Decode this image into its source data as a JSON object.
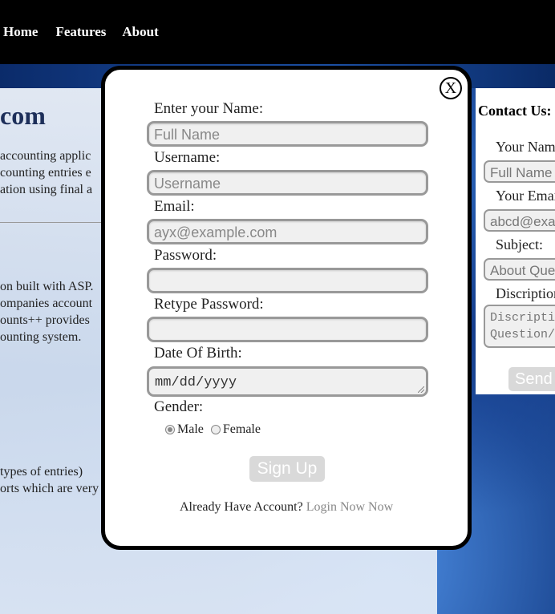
{
  "nav": {
    "items": [
      "Home",
      "Features",
      "About"
    ]
  },
  "left": {
    "brand": "com",
    "para1": "accounting applic\ncounting entries e\nation using final a",
    "para2": "on built with ASP.\nompanies account\nounts++ provides\nounting system.",
    "para3": "types of entries)\norts which are very"
  },
  "contact": {
    "title": "Contact Us:",
    "name_label": "Your Name",
    "name_placeholder": "Full Name",
    "email_label": "Your Email",
    "email_placeholder": "abcd@example.com",
    "subject_label": "Subject:",
    "subject_placeholder": "About Question",
    "description_label": "Discription",
    "description_placeholder": "Discription\nQuestion/",
    "send_label": "Send"
  },
  "modal": {
    "close_label": "X",
    "name_label": "Enter your Name:",
    "name_placeholder": "Full Name",
    "username_label": "Username:",
    "username_placeholder": "Username",
    "email_label": "Email:",
    "email_placeholder": "ayx@example.com",
    "password_label": "Password:",
    "password_value": "",
    "retype_label": "Retype Password:",
    "retype_value": "",
    "dob_label": "Date Of Birth:",
    "dob_placeholder": "mm/dd/yyyy",
    "gender_label": "Gender:",
    "gender_options": [
      "Male",
      "Female"
    ],
    "gender_selected": "Male",
    "signup_label": "Sign Up",
    "already_text": "Already Have Account?",
    "login_link": "Login Now Now"
  }
}
